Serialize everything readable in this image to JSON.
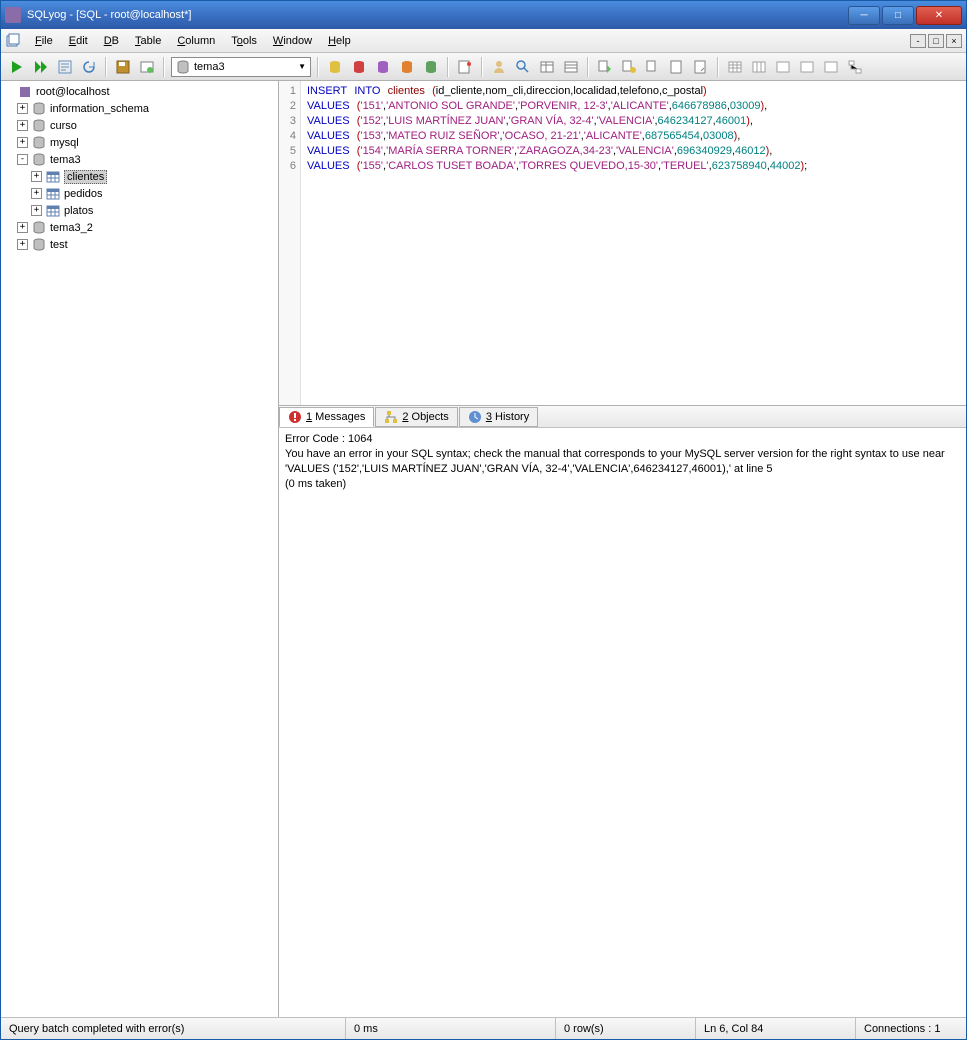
{
  "window": {
    "title": "SQLyog - [SQL - root@localhost*]"
  },
  "menu": {
    "file": "File",
    "edit": "Edit",
    "db": "DB",
    "table": "Table",
    "column": "Column",
    "tools": "Tools",
    "window": "Window",
    "help": "Help"
  },
  "toolbar": {
    "db_selected": "tema3"
  },
  "tree": {
    "root": "root@localhost",
    "nodes": [
      {
        "label": "information_schema"
      },
      {
        "label": "curso"
      },
      {
        "label": "mysql"
      },
      {
        "label": "tema3",
        "expanded": true,
        "children": [
          {
            "label": "clientes",
            "selected": true
          },
          {
            "label": "pedidos"
          },
          {
            "label": "platos"
          }
        ]
      },
      {
        "label": "tema3_2"
      },
      {
        "label": "test"
      }
    ]
  },
  "editor": {
    "lines": [
      "1",
      "2",
      "3",
      "4",
      "5",
      "6"
    ],
    "code": [
      {
        "kw1": "INSERT",
        "kw2": "INTO",
        "ident": "clientes",
        "cols": "id_cliente,nom_cli,direccion,localidad,telefono,c_postal"
      },
      {
        "kw": "VALUES",
        "v1": "'151'",
        "v2": "'ANTONIO SOL GRANDE'",
        "v3": "'PORVENIR, 12-3'",
        "v4": "'ALICANTE'",
        "n1": "646678986",
        "n2": "03009",
        "end": ","
      },
      {
        "kw": "VALUES",
        "v1": "'152'",
        "v2": "'LUIS MARTÍNEZ JUAN'",
        "v3": "'GRAN VÍA, 32-4'",
        "v4": "'VALENCIA'",
        "n1": "646234127",
        "n2": "46001",
        "end": ","
      },
      {
        "kw": "VALUES",
        "v1": "'153'",
        "v2": "'MATEO RUIZ SEÑOR'",
        "v3": "'OCASO, 21-21'",
        "v4": "'ALICANTE'",
        "n1": "687565454",
        "n2": "03008",
        "end": ","
      },
      {
        "kw": "VALUES",
        "v1": "'154'",
        "v2": "'MARÍA SERRA TORNER'",
        "v3": "'ZARAGOZA,34-23'",
        "v4": "'VALENCIA'",
        "n1": "696340929",
        "n2": "46012",
        "end": ","
      },
      {
        "kw": "VALUES",
        "v1": "'155'",
        "v2": "'CARLOS TUSET BOADA'",
        "v3": "'TORRES QUEVEDO,15-30'",
        "v4": "'TERUEL'",
        "n1": "623758940",
        "n2": "44002",
        "end": ";"
      }
    ]
  },
  "tabs": {
    "messages": "1 Messages",
    "objects": "2 Objects",
    "history": "3 History"
  },
  "messages": {
    "line1": "Error Code : 1064",
    "line2": "You have an error in your SQL syntax; check the manual that corresponds to your MySQL server version for the right syntax to use near 'VALUES ('152','LUIS MARTÍNEZ JUAN','GRAN VÍA, 32-4','VALENCIA',646234127,46001),' at line 5",
    "line3": "(0 ms taken)"
  },
  "status": {
    "msg": "Query batch completed with error(s)",
    "time": "0 ms",
    "rows": "0 row(s)",
    "cursor": "Ln 6, Col 84",
    "conn": "Connections : 1"
  }
}
